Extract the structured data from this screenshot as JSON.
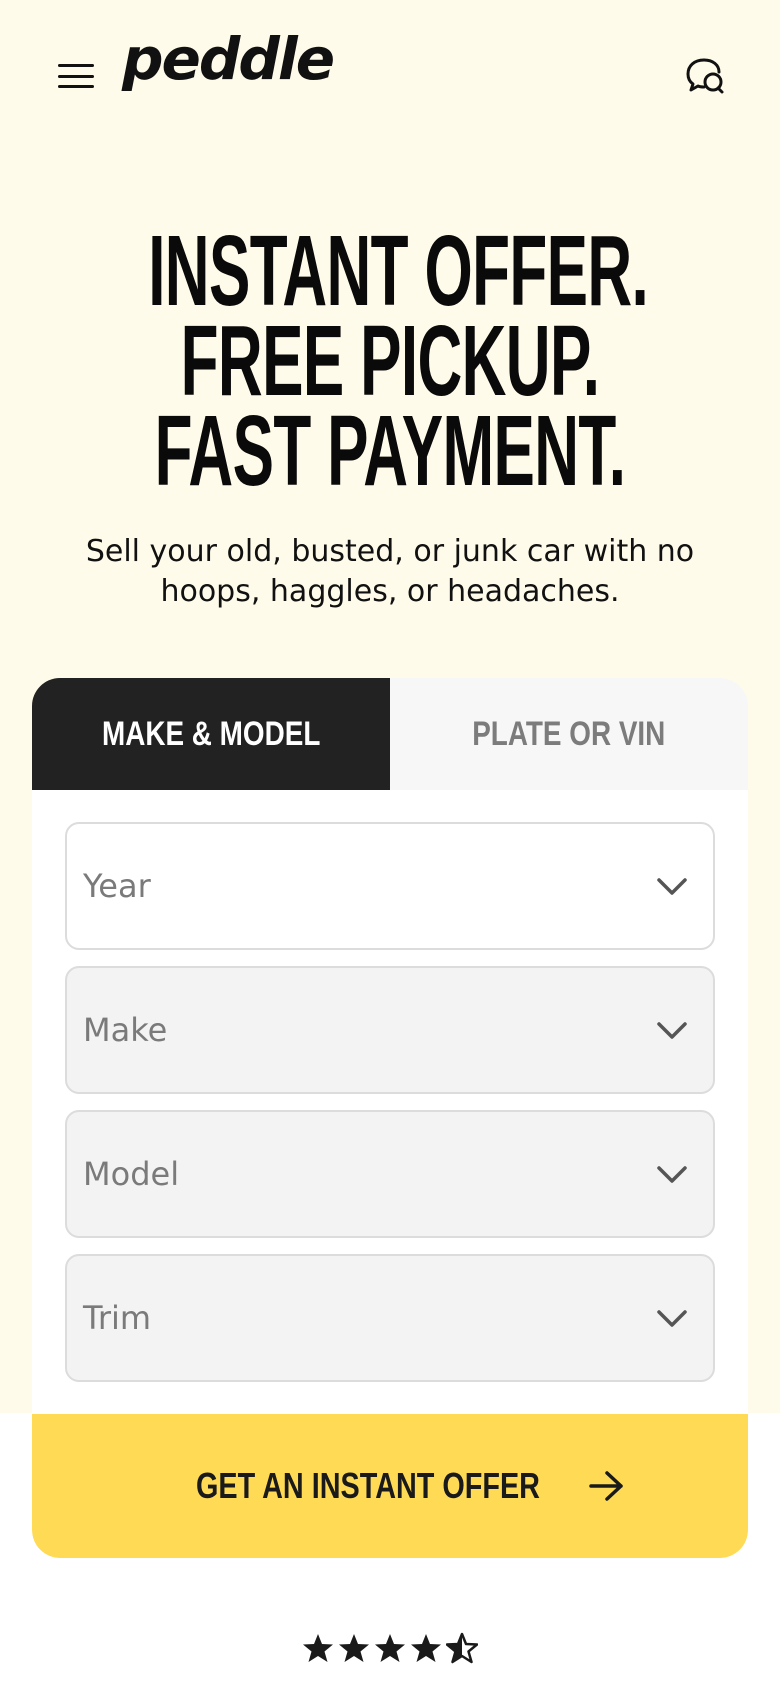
{
  "header": {
    "logo_text": "peddle",
    "menu_icon": "hamburger-menu-icon",
    "chat_icon": "chat-bubbles-icon"
  },
  "hero": {
    "headline_lines": [
      "INSTANT OFFER.",
      "FREE PICKUP.",
      "FAST PAYMENT."
    ],
    "subtext": "Sell your old, busted, or junk car with no hoops, haggles, or headaches."
  },
  "form": {
    "tabs": [
      {
        "label": "MAKE & MODEL",
        "active": true
      },
      {
        "label": "PLATE OR VIN",
        "active": false
      }
    ],
    "fields": [
      {
        "placeholder": "Year",
        "enabled": true
      },
      {
        "placeholder": "Make",
        "enabled": false
      },
      {
        "placeholder": "Model",
        "enabled": false
      },
      {
        "placeholder": "Trim",
        "enabled": false
      }
    ],
    "cta_label": "GET AN INSTANT OFFER"
  },
  "rating": {
    "stars": 4.5
  },
  "colors": {
    "hero_bg": "#fffbea",
    "tab_active_bg": "#222222",
    "tab_inactive_bg": "#f7f7f7",
    "cta_bg": "#ffda55"
  }
}
